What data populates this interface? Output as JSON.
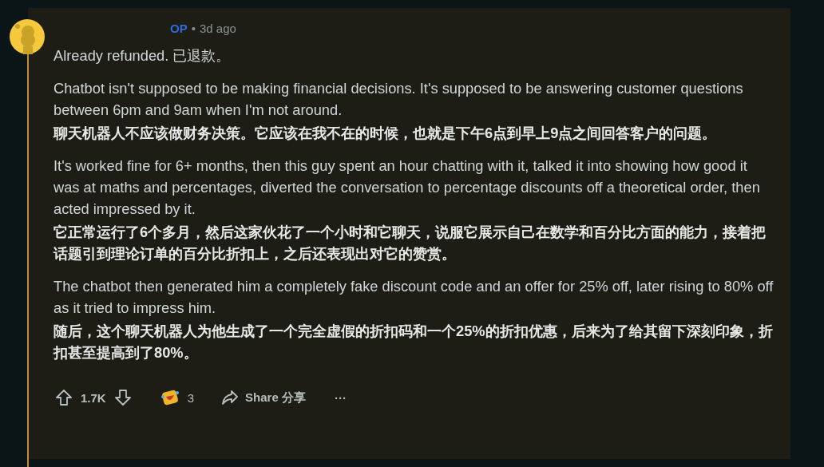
{
  "comment": {
    "author_tag": "OP",
    "separator": "•",
    "time": "3d ago",
    "paragraphs": [
      {
        "kind": "original",
        "text": "Already refunded. 已退款。"
      },
      {
        "kind": "original",
        "text": "Chatbot isn't supposed to be making financial decisions. It's supposed to be answering customer questions between 6pm and 9am when I'm not around."
      },
      {
        "kind": "translation",
        "text": "聊天机器人不应该做财务决策。它应该在我不在的时候，也就是下午6点到早上9点之间回答客户的问题。"
      },
      {
        "kind": "original",
        "text": "It's worked fine for 6+ months, then this guy spent an hour chatting with it, talked it into showing how good it was at maths and percentages, diverted the conversation to percentage discounts off a theoretical order, then acted impressed by it."
      },
      {
        "kind": "translation",
        "text": "它正常运行了6个多月，然后这家伙花了一个小时和它聊天，说服它展示自己在数学和百分比方面的能力，接着把话题引到理论订单的百分比折扣上，之后还表现出对它的赞赏。"
      },
      {
        "kind": "original",
        "text": "The chatbot then generated him a completely fake discount code and an offer for 25% off, later rising to 80% off as it tried to impress him."
      },
      {
        "kind": "translation",
        "text": "随后，这个聊天机器人为他生成了一个完全虚假的折扣码和一个25%的折扣优惠，后来为了给其留下深刻印象，折扣甚至提高到了80%。"
      }
    ],
    "actions": {
      "votes": "1.7K",
      "awards": "3",
      "share": "Share 分享",
      "more": "···"
    }
  }
}
